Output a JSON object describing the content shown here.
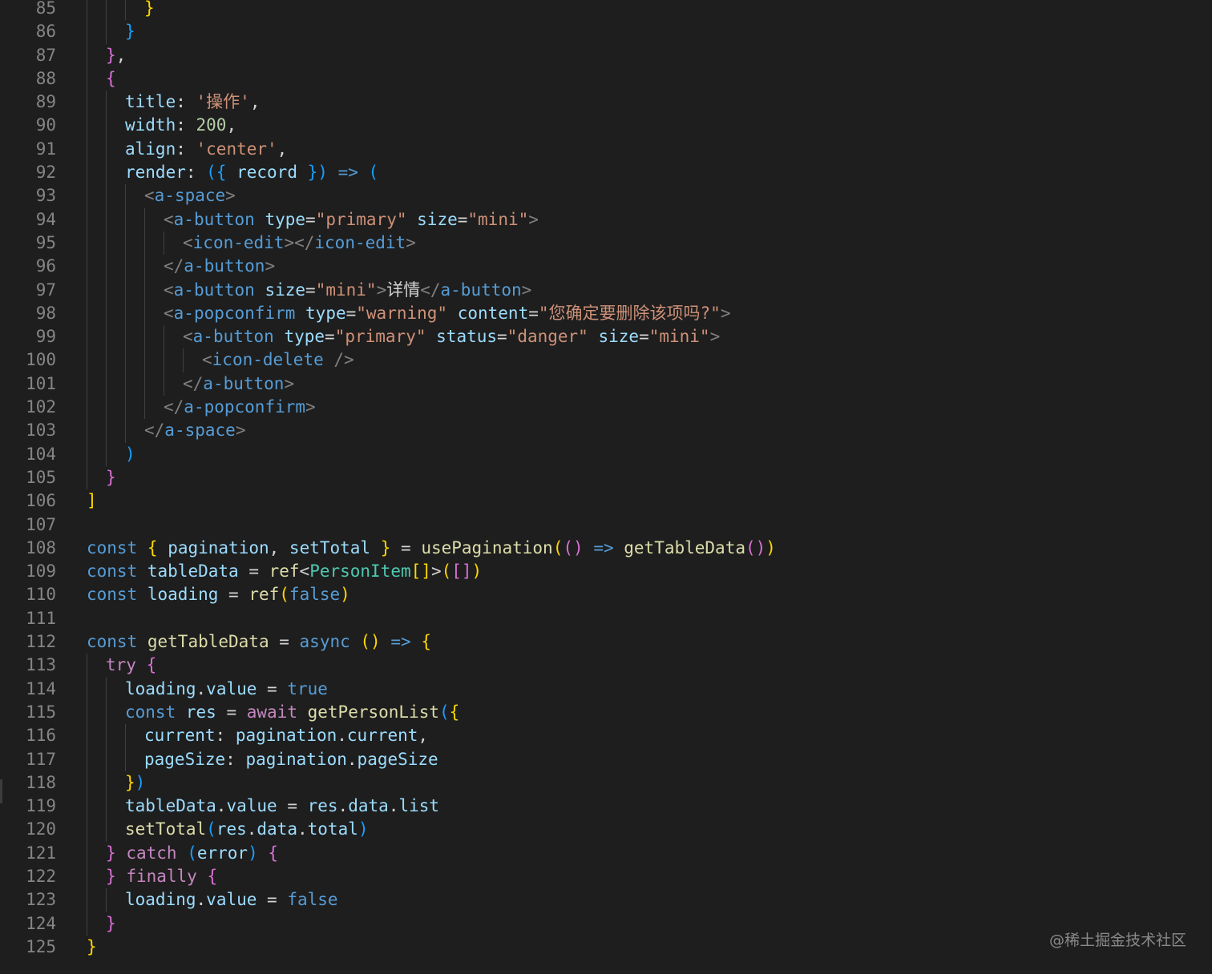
{
  "editor": {
    "watermark": "@稀土掘金技术社区",
    "lines": [
      {
        "n": "85",
        "indent": 3,
        "tokens": [
          [
            "}",
            "b1"
          ]
        ]
      },
      {
        "n": "86",
        "indent": 2,
        "tokens": [
          [
            "}",
            "b3"
          ]
        ]
      },
      {
        "n": "87",
        "indent": 1,
        "tokens": [
          [
            "}",
            "b2"
          ],
          [
            ",",
            "p"
          ]
        ]
      },
      {
        "n": "88",
        "indent": 1,
        "tokens": [
          [
            "{",
            "b2"
          ]
        ]
      },
      {
        "n": "89",
        "indent": 2,
        "tokens": [
          [
            "title",
            "var"
          ],
          [
            ": ",
            "p"
          ],
          [
            "'操作'",
            "str"
          ],
          [
            ",",
            "p"
          ]
        ]
      },
      {
        "n": "90",
        "indent": 2,
        "tokens": [
          [
            "width",
            "var"
          ],
          [
            ": ",
            "p"
          ],
          [
            "200",
            "num"
          ],
          [
            ",",
            "p"
          ]
        ]
      },
      {
        "n": "91",
        "indent": 2,
        "tokens": [
          [
            "align",
            "var"
          ],
          [
            ": ",
            "p"
          ],
          [
            "'center'",
            "str"
          ],
          [
            ",",
            "p"
          ]
        ]
      },
      {
        "n": "92",
        "indent": 2,
        "tokens": [
          [
            "render",
            "var"
          ],
          [
            ": ",
            "p"
          ],
          [
            "({",
            "b3"
          ],
          [
            " ",
            "p"
          ],
          [
            "record",
            "var"
          ],
          [
            " ",
            "p"
          ],
          [
            "})",
            "b3"
          ],
          [
            " ",
            "p"
          ],
          [
            "=>",
            "kw"
          ],
          [
            " ",
            "p"
          ],
          [
            "(",
            "b3"
          ]
        ]
      },
      {
        "n": "93",
        "indent": 3,
        "tokens": [
          [
            "<",
            "punc"
          ],
          [
            "a-space",
            "tag"
          ],
          [
            ">",
            "punc"
          ]
        ]
      },
      {
        "n": "94",
        "indent": 4,
        "tokens": [
          [
            "<",
            "punc"
          ],
          [
            "a-button",
            "tag"
          ],
          [
            " ",
            "p"
          ],
          [
            "type",
            "attr"
          ],
          [
            "=",
            "p"
          ],
          [
            "\"primary\"",
            "str"
          ],
          [
            " ",
            "p"
          ],
          [
            "size",
            "attr"
          ],
          [
            "=",
            "p"
          ],
          [
            "\"mini\"",
            "str"
          ],
          [
            ">",
            "punc"
          ]
        ]
      },
      {
        "n": "95",
        "indent": 5,
        "tokens": [
          [
            "<",
            "punc"
          ],
          [
            "icon-edit",
            "tag"
          ],
          [
            "></",
            "punc"
          ],
          [
            "icon-edit",
            "tag"
          ],
          [
            ">",
            "punc"
          ]
        ]
      },
      {
        "n": "96",
        "indent": 4,
        "tokens": [
          [
            "</",
            "punc"
          ],
          [
            "a-button",
            "tag"
          ],
          [
            ">",
            "punc"
          ]
        ]
      },
      {
        "n": "97",
        "indent": 4,
        "tokens": [
          [
            "<",
            "punc"
          ],
          [
            "a-button",
            "tag"
          ],
          [
            " ",
            "p"
          ],
          [
            "size",
            "attr"
          ],
          [
            "=",
            "p"
          ],
          [
            "\"mini\"",
            "str"
          ],
          [
            ">",
            "punc"
          ],
          [
            "详情",
            "p"
          ],
          [
            "</",
            "punc"
          ],
          [
            "a-button",
            "tag"
          ],
          [
            ">",
            "punc"
          ]
        ]
      },
      {
        "n": "98",
        "indent": 4,
        "tokens": [
          [
            "<",
            "punc"
          ],
          [
            "a-popconfirm",
            "tag"
          ],
          [
            " ",
            "p"
          ],
          [
            "type",
            "attr"
          ],
          [
            "=",
            "p"
          ],
          [
            "\"warning\"",
            "str"
          ],
          [
            " ",
            "p"
          ],
          [
            "content",
            "attr"
          ],
          [
            "=",
            "p"
          ],
          [
            "\"您确定要删除该项吗?\"",
            "str"
          ],
          [
            ">",
            "punc"
          ]
        ]
      },
      {
        "n": "99",
        "indent": 5,
        "tokens": [
          [
            "<",
            "punc"
          ],
          [
            "a-button",
            "tag"
          ],
          [
            " ",
            "p"
          ],
          [
            "type",
            "attr"
          ],
          [
            "=",
            "p"
          ],
          [
            "\"primary\"",
            "str"
          ],
          [
            " ",
            "p"
          ],
          [
            "status",
            "attr"
          ],
          [
            "=",
            "p"
          ],
          [
            "\"danger\"",
            "str"
          ],
          [
            " ",
            "p"
          ],
          [
            "size",
            "attr"
          ],
          [
            "=",
            "p"
          ],
          [
            "\"mini\"",
            "str"
          ],
          [
            ">",
            "punc"
          ]
        ]
      },
      {
        "n": "100",
        "indent": 6,
        "tokens": [
          [
            "<",
            "punc"
          ],
          [
            "icon-delete",
            "tag"
          ],
          [
            " />",
            "punc"
          ]
        ]
      },
      {
        "n": "101",
        "indent": 5,
        "tokens": [
          [
            "</",
            "punc"
          ],
          [
            "a-button",
            "tag"
          ],
          [
            ">",
            "punc"
          ]
        ]
      },
      {
        "n": "102",
        "indent": 4,
        "tokens": [
          [
            "</",
            "punc"
          ],
          [
            "a-popconfirm",
            "tag"
          ],
          [
            ">",
            "punc"
          ]
        ]
      },
      {
        "n": "103",
        "indent": 3,
        "tokens": [
          [
            "</",
            "punc"
          ],
          [
            "a-space",
            "tag"
          ],
          [
            ">",
            "punc"
          ]
        ]
      },
      {
        "n": "104",
        "indent": 2,
        "tokens": [
          [
            ")",
            "b3"
          ]
        ]
      },
      {
        "n": "105",
        "indent": 1,
        "tokens": [
          [
            "}",
            "b2"
          ]
        ]
      },
      {
        "n": "106",
        "indent": 0,
        "tokens": [
          [
            "]",
            "b1"
          ]
        ]
      },
      {
        "n": "107",
        "indent": 0,
        "tokens": []
      },
      {
        "n": "108",
        "indent": 0,
        "tokens": [
          [
            "const",
            "kw"
          ],
          [
            " ",
            "p"
          ],
          [
            "{",
            "b1"
          ],
          [
            " ",
            "p"
          ],
          [
            "pagination",
            "var"
          ],
          [
            ", ",
            "p"
          ],
          [
            "setTotal",
            "var"
          ],
          [
            " ",
            "p"
          ],
          [
            "}",
            "b1"
          ],
          [
            " = ",
            "p"
          ],
          [
            "usePagination",
            "fn"
          ],
          [
            "(",
            "b1"
          ],
          [
            "()",
            "b2"
          ],
          [
            " ",
            "p"
          ],
          [
            "=>",
            "kw"
          ],
          [
            " ",
            "p"
          ],
          [
            "getTableData",
            "fn"
          ],
          [
            "()",
            "b2"
          ],
          [
            ")",
            "b1"
          ]
        ]
      },
      {
        "n": "109",
        "indent": 0,
        "tokens": [
          [
            "const",
            "kw"
          ],
          [
            " ",
            "p"
          ],
          [
            "tableData",
            "var"
          ],
          [
            " = ",
            "p"
          ],
          [
            "ref",
            "fn"
          ],
          [
            "<",
            "p"
          ],
          [
            "PersonItem",
            "type"
          ],
          [
            "[]",
            "b1"
          ],
          [
            ">",
            "p"
          ],
          [
            "(",
            "b1"
          ],
          [
            "[]",
            "b2"
          ],
          [
            ")",
            "b1"
          ]
        ]
      },
      {
        "n": "110",
        "indent": 0,
        "tokens": [
          [
            "const",
            "kw"
          ],
          [
            " ",
            "p"
          ],
          [
            "loading",
            "var"
          ],
          [
            " = ",
            "p"
          ],
          [
            "ref",
            "fn"
          ],
          [
            "(",
            "b1"
          ],
          [
            "false",
            "kw"
          ],
          [
            ")",
            "b1"
          ]
        ]
      },
      {
        "n": "111",
        "indent": 0,
        "tokens": []
      },
      {
        "n": "112",
        "indent": 0,
        "tokens": [
          [
            "const",
            "kw"
          ],
          [
            " ",
            "p"
          ],
          [
            "getTableData",
            "fn"
          ],
          [
            " = ",
            "p"
          ],
          [
            "async",
            "kw"
          ],
          [
            " ",
            "p"
          ],
          [
            "()",
            "b1"
          ],
          [
            " ",
            "p"
          ],
          [
            "=>",
            "kw"
          ],
          [
            " ",
            "p"
          ],
          [
            "{",
            "b1"
          ]
        ]
      },
      {
        "n": "113",
        "indent": 1,
        "tokens": [
          [
            "try",
            "ctl"
          ],
          [
            " ",
            "p"
          ],
          [
            "{",
            "b2"
          ]
        ]
      },
      {
        "n": "114",
        "indent": 2,
        "tokens": [
          [
            "loading",
            "var"
          ],
          [
            ".",
            "p"
          ],
          [
            "value",
            "var"
          ],
          [
            " = ",
            "p"
          ],
          [
            "true",
            "kw"
          ]
        ]
      },
      {
        "n": "115",
        "indent": 2,
        "tokens": [
          [
            "const",
            "kw"
          ],
          [
            " ",
            "p"
          ],
          [
            "res",
            "var"
          ],
          [
            " = ",
            "p"
          ],
          [
            "await",
            "ctl"
          ],
          [
            " ",
            "p"
          ],
          [
            "getPersonList",
            "fn"
          ],
          [
            "(",
            "b3"
          ],
          [
            "{",
            "b1"
          ]
        ]
      },
      {
        "n": "116",
        "indent": 3,
        "tokens": [
          [
            "current",
            "var"
          ],
          [
            ": ",
            "p"
          ],
          [
            "pagination",
            "var"
          ],
          [
            ".",
            "p"
          ],
          [
            "current",
            "var"
          ],
          [
            ",",
            "p"
          ]
        ]
      },
      {
        "n": "117",
        "indent": 3,
        "tokens": [
          [
            "pageSize",
            "var"
          ],
          [
            ": ",
            "p"
          ],
          [
            "pagination",
            "var"
          ],
          [
            ".",
            "p"
          ],
          [
            "pageSize",
            "var"
          ]
        ]
      },
      {
        "n": "118",
        "indent": 2,
        "tokens": [
          [
            "}",
            "b1"
          ],
          [
            ")",
            "b3"
          ]
        ]
      },
      {
        "n": "119",
        "indent": 2,
        "tokens": [
          [
            "tableData",
            "var"
          ],
          [
            ".",
            "p"
          ],
          [
            "value",
            "var"
          ],
          [
            " = ",
            "p"
          ],
          [
            "res",
            "var"
          ],
          [
            ".",
            "p"
          ],
          [
            "data",
            "var"
          ],
          [
            ".",
            "p"
          ],
          [
            "list",
            "var"
          ]
        ]
      },
      {
        "n": "120",
        "indent": 2,
        "tokens": [
          [
            "setTotal",
            "fn"
          ],
          [
            "(",
            "b3"
          ],
          [
            "res",
            "var"
          ],
          [
            ".",
            "p"
          ],
          [
            "data",
            "var"
          ],
          [
            ".",
            "p"
          ],
          [
            "total",
            "var"
          ],
          [
            ")",
            "b3"
          ]
        ]
      },
      {
        "n": "121",
        "indent": 1,
        "tokens": [
          [
            "}",
            "b2"
          ],
          [
            " ",
            "p"
          ],
          [
            "catch",
            "ctl"
          ],
          [
            " ",
            "p"
          ],
          [
            "(",
            "b3"
          ],
          [
            "error",
            "var"
          ],
          [
            ")",
            "b3"
          ],
          [
            " ",
            "p"
          ],
          [
            "{",
            "b2"
          ]
        ]
      },
      {
        "n": "122",
        "indent": 1,
        "tokens": [
          [
            "}",
            "b2"
          ],
          [
            " ",
            "p"
          ],
          [
            "finally",
            "ctl"
          ],
          [
            " ",
            "p"
          ],
          [
            "{",
            "b2"
          ]
        ]
      },
      {
        "n": "123",
        "indent": 2,
        "tokens": [
          [
            "loading",
            "var"
          ],
          [
            ".",
            "p"
          ],
          [
            "value",
            "var"
          ],
          [
            " = ",
            "p"
          ],
          [
            "false",
            "kw"
          ]
        ]
      },
      {
        "n": "124",
        "indent": 1,
        "tokens": [
          [
            "}",
            "b2"
          ]
        ]
      },
      {
        "n": "125",
        "indent": 0,
        "tokens": [
          [
            "}",
            "b1"
          ]
        ]
      }
    ]
  }
}
